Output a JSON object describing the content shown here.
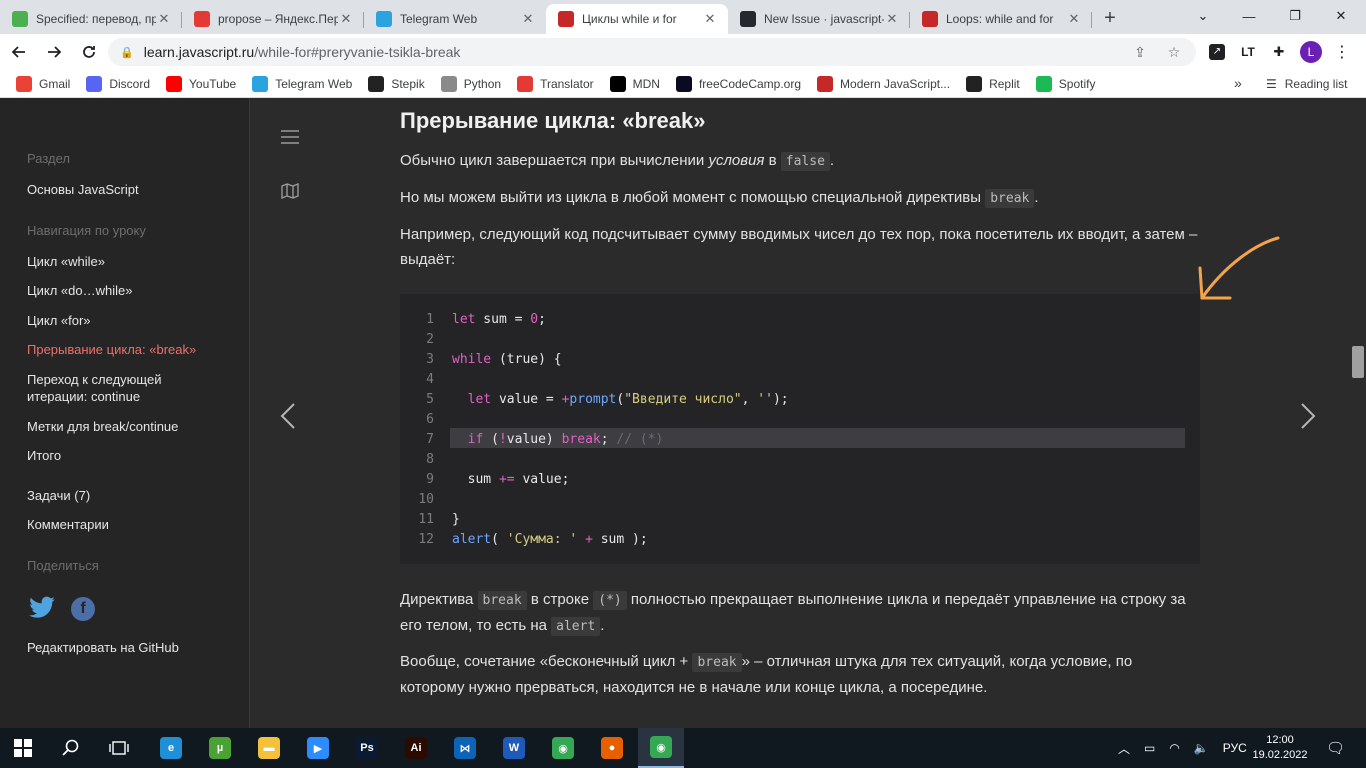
{
  "browser": {
    "tabs": [
      {
        "title": "Specified: перевод, пр",
        "icon": "specified-icon",
        "color": "#4caf50"
      },
      {
        "title": "propose – Яндекс.Пер",
        "icon": "yandex-translate-icon",
        "color": "#e53935"
      },
      {
        "title": "Telegram Web",
        "icon": "telegram-icon",
        "color": "#2aa3df"
      },
      {
        "title": "Циклы while и for",
        "icon": "javascript-info-icon",
        "color": "#c62828"
      },
      {
        "title": "New Issue · javascript-",
        "icon": "github-icon",
        "color": "#24292f"
      },
      {
        "title": "Loops: while and for",
        "icon": "javascript-info-icon",
        "color": "#c62828"
      }
    ],
    "new_tab": "+",
    "window_controls": {
      "menu": "⌄",
      "minimize": "—",
      "restore": "❐",
      "close": "✕"
    },
    "url_host": "learn.javascript.ru",
    "url_path": "/while-for#preryvanie-tsikla-break",
    "profile_initial": "L",
    "bookmarks": [
      {
        "label": "Gmail",
        "icon": "gmail-icon",
        "color": "#ea4335"
      },
      {
        "label": "Discord",
        "icon": "discord-icon",
        "color": "#5865f2"
      },
      {
        "label": "YouTube",
        "icon": "youtube-icon",
        "color": "#ff0000"
      },
      {
        "label": "Telegram Web",
        "icon": "telegram-icon",
        "color": "#2aa3df"
      },
      {
        "label": "Stepik",
        "icon": "stepik-icon",
        "color": "#222222"
      },
      {
        "label": "Python",
        "icon": "python-icon",
        "color": "#8a8a8a"
      },
      {
        "label": "Translator",
        "icon": "translator-icon",
        "color": "#e53935"
      },
      {
        "label": "MDN",
        "icon": "mdn-icon",
        "color": "#000000"
      },
      {
        "label": "freeCodeCamp.org",
        "icon": "freecodecamp-icon",
        "color": "#0a0a23"
      },
      {
        "label": "Modern JavaScript...",
        "icon": "javascript-info-icon",
        "color": "#c62828"
      },
      {
        "label": "Replit",
        "icon": "replit-icon",
        "color": "#222222"
      },
      {
        "label": "Spotify",
        "icon": "spotify-icon",
        "color": "#1db954"
      }
    ],
    "bookmarks_more": "»",
    "reading_list": "Reading list"
  },
  "sidebar": {
    "section_heading": "Раздел",
    "section_link": "Основы JavaScript",
    "nav_heading": "Навигация по уроку",
    "nav_items": [
      "Цикл «while»",
      "Цикл «do…while»",
      "Цикл «for»",
      "Прерывание цикла: «break»",
      "Переход к следующей итерации: continue",
      "Метки для break/continue",
      "Итого"
    ],
    "tasks": "Задачи (7)",
    "comments": "Комментарии",
    "share_heading": "Поделиться",
    "edit_github": "Редактировать на GitHub"
  },
  "article": {
    "heading": "Прерывание цикла: «break»",
    "p1_before": "Обычно цикл завершается при вычислении ",
    "p1_italic": "условия",
    "p1_mid": " в ",
    "p1_code": "false",
    "p1_after": ".",
    "p2_before": "Но мы можем выйти из цикла в любой момент с помощью специальной директивы ",
    "p2_code": "break",
    "p2_after": ".",
    "p3": "Например, следующий код подсчитывает сумму вводимых чисел до тех пор, пока посетитель их вводит, а затем – выдаёт:",
    "code_lines": [
      "let sum = 0;",
      "",
      "while (true) {",
      "",
      "  let value = +prompt(\"Введите число\", '');",
      "",
      "  if (!value) break; // (*)",
      "",
      "  sum += value;",
      "",
      "}",
      "alert( 'Сумма: ' + sum );"
    ],
    "highlighted_line": 7,
    "p4_a": "Директива ",
    "p4_code1": "break",
    "p4_b": " в строке ",
    "p4_code2": "(*)",
    "p4_c": " полностью прекращает выполнение цикла и передаёт управление на строку за его телом, то есть на ",
    "p4_code3": "alert",
    "p4_d": ".",
    "p5_a": "Вообще, сочетание «бесконечный цикл + ",
    "p5_code": "break",
    "p5_b": "» – отличная штука для тех ситуаций, когда условие, по которому нужно прерваться, находится не в начале или конце цикла, а посередине."
  },
  "taskbar": {
    "apps": [
      {
        "icon": "edge-icon",
        "color": "#1f8fd6",
        "glyph": "e"
      },
      {
        "icon": "utorrent-icon",
        "color": "#4aa234",
        "glyph": "µ"
      },
      {
        "icon": "file-explorer-icon",
        "color": "#f3c13a",
        "glyph": "▬"
      },
      {
        "icon": "zoom-icon",
        "color": "#2d8cff",
        "glyph": "▶"
      },
      {
        "icon": "photoshop-icon",
        "color": "#0a1a33",
        "glyph": "Ps"
      },
      {
        "icon": "illustrator-icon",
        "color": "#2b0b00",
        "glyph": "Ai"
      },
      {
        "icon": "vscode-icon",
        "color": "#0d63b8",
        "glyph": "⋈"
      },
      {
        "icon": "word-icon",
        "color": "#1e5bb8",
        "glyph": "W"
      },
      {
        "icon": "chrome-icon",
        "color": "#34a853",
        "glyph": "◉"
      },
      {
        "icon": "firefox-icon",
        "color": "#e66000",
        "glyph": "●"
      },
      {
        "icon": "chrome-profile-icon",
        "color": "#34a853",
        "glyph": "◉"
      }
    ],
    "lang": "РУС",
    "time": "12:00",
    "date": "19.02.2022"
  },
  "colors": {
    "accent": "#ef6f6f",
    "keyword": "#e260c4",
    "function": "#6ba6ff",
    "string": "#d6cd80",
    "annotation_arrow": "#f3a34a"
  }
}
